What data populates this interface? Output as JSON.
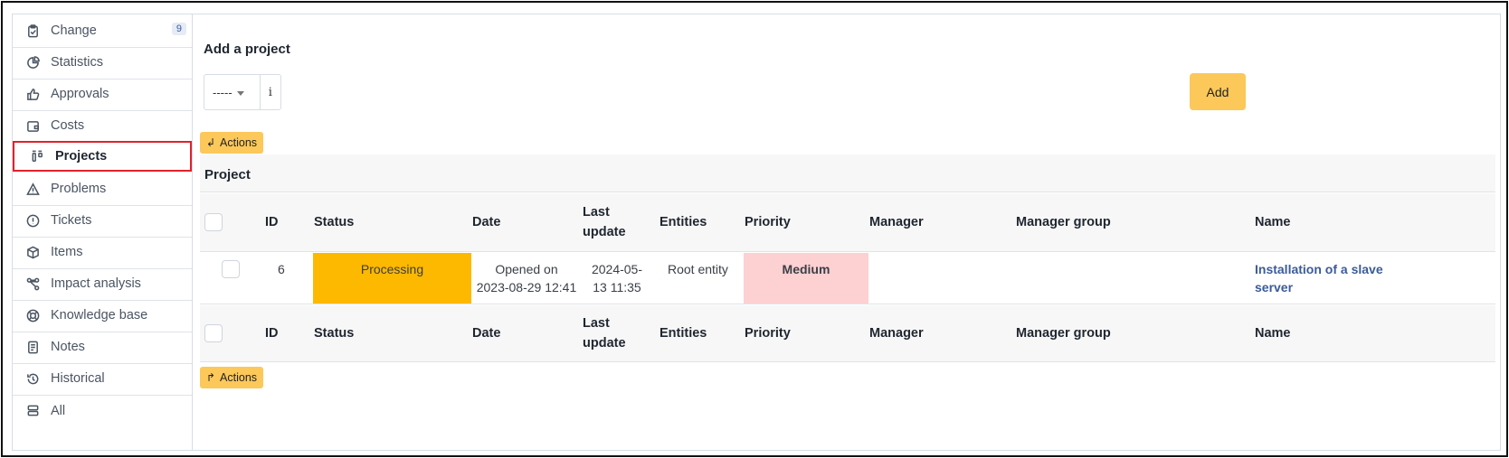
{
  "sidebar": {
    "items": [
      {
        "label": "Change",
        "icon": "clipboard-check-icon",
        "badge": "9"
      },
      {
        "label": "Statistics",
        "icon": "pie-chart-icon"
      },
      {
        "label": "Approvals",
        "icon": "thumbs-up-icon"
      },
      {
        "label": "Costs",
        "icon": "wallet-icon"
      },
      {
        "label": "Projects",
        "icon": "projects-icon",
        "active": true
      },
      {
        "label": "Problems",
        "icon": "warning-triangle-icon"
      },
      {
        "label": "Tickets",
        "icon": "alert-circle-icon"
      },
      {
        "label": "Items",
        "icon": "package-icon"
      },
      {
        "label": "Impact analysis",
        "icon": "network-icon"
      },
      {
        "label": "Knowledge base",
        "icon": "lifebuoy-icon"
      },
      {
        "label": "Notes",
        "icon": "note-icon"
      },
      {
        "label": "Historical",
        "icon": "history-icon"
      },
      {
        "label": "All",
        "icon": "stack-icon"
      }
    ]
  },
  "add_project": {
    "title": "Add a project",
    "select_value": "-----",
    "info_label": "i",
    "add_label": "Add"
  },
  "actions_label": "Actions",
  "table": {
    "caption": "Project",
    "headers": {
      "id": "ID",
      "status": "Status",
      "date": "Date",
      "last_update_1": "Last",
      "last_update_2": "update",
      "entities": "Entities",
      "priority": "Priority",
      "manager": "Manager",
      "manager_group": "Manager group",
      "name": "Name"
    },
    "rows": [
      {
        "id": "6",
        "status": "Processing",
        "date_1": "Opened on",
        "date_2": "2023-08-29 12:41",
        "last_update_1": "2024-05-",
        "last_update_2": "13 11:35",
        "entities": "Root entity",
        "priority": "Medium",
        "manager": "",
        "manager_group": "",
        "name_1": "Installation of a slave",
        "name_2": "server"
      }
    ]
  },
  "colors": {
    "accent": "#fcc85a",
    "status_processing": "#fdb800",
    "priority_medium": "#fdd0d2",
    "link": "#3b5b9a",
    "highlight_border": "#e0212b"
  }
}
